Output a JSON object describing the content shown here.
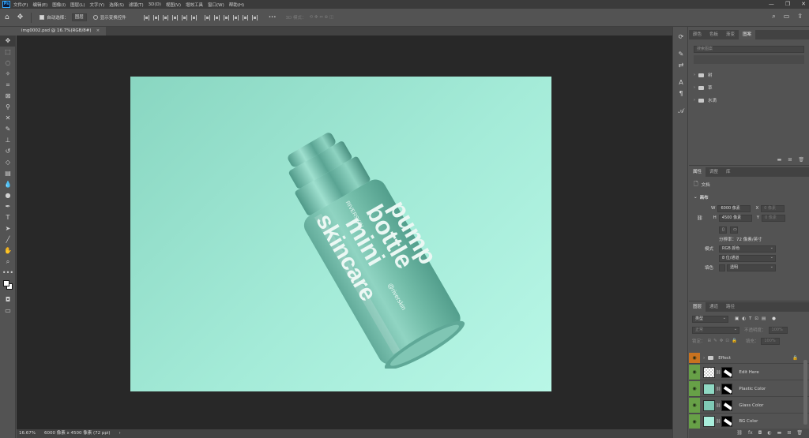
{
  "menu": {
    "logo": "Ps",
    "items": [
      "文件(F)",
      "编辑(E)",
      "图像(I)",
      "图层(L)",
      "文字(Y)",
      "选择(S)",
      "滤镜(T)",
      "3D(D)",
      "视图(V)",
      "增效工具",
      "窗口(W)",
      "帮助(H)"
    ],
    "window_controls": [
      "—",
      "❐",
      "✕"
    ]
  },
  "options": {
    "auto_select_label": "自动选择：",
    "auto_select_value": "图层",
    "show_transform_label": "显示变换控件",
    "more": "•••",
    "mode_3d_label": "3D 模式："
  },
  "document": {
    "tab_title": "img0002.psd @ 16.7%(RGB/8#)",
    "close": "×"
  },
  "status": {
    "zoom": "16.67%",
    "size_info": "6000 像素 x 4500 像素 (72 ppi)",
    "arrow": "›"
  },
  "library_panel": {
    "tabs": [
      "颜色",
      "色板",
      "渐变",
      "图案"
    ],
    "active_tab": 3,
    "search_placeholder": "搜索图案",
    "folders": [
      "树",
      "草",
      "水滴"
    ]
  },
  "properties_panel": {
    "tabs": [
      "属性",
      "调整",
      "库"
    ],
    "active_tab": 0,
    "doc_label": "文档",
    "section_title": "画布",
    "w_label": "W",
    "w_value": "6000 像素",
    "h_label": "H",
    "h_value": "4500 像素",
    "x_label": "X",
    "x_value": "0 像素",
    "y_label": "Y",
    "y_value": "0 像素",
    "resolution": "分辨率：72 像素/英寸",
    "mode_label": "模式",
    "mode_value": "RGB 颜色",
    "depth_value": "8 位/通道",
    "fill_label": "填色",
    "fill_value": "透明"
  },
  "layers_panel": {
    "tabs": [
      "图层",
      "通道",
      "路径"
    ],
    "active_tab": 0,
    "filter_value": "类型",
    "blend_mode": "正常",
    "opacity_label": "不透明度：",
    "opacity_value": "100%",
    "lock_label": "锁定：",
    "fill_label": "填充：",
    "fill_value": "100%",
    "layers": [
      {
        "name": "Effect",
        "type": "group",
        "thumb": "#535353"
      },
      {
        "name": "Edit Here",
        "type": "smart",
        "thumb": "#ffffff"
      },
      {
        "name": "Plastic Color",
        "type": "fill",
        "thumb": "#8fd8c3"
      },
      {
        "name": "Glass Color",
        "type": "fill",
        "thumb": "#7fc9b5"
      },
      {
        "name": "BG Color",
        "type": "fill",
        "thumb": "#a9eedc"
      }
    ]
  },
  "canvas": {
    "bottle_text_1": "skincare",
    "bottle_text_2": "mini",
    "bottle_text_3": "bottle",
    "bottle_text_4": "pump",
    "bottle_small_1": "RIVERSKIN",
    "bottle_small_2": "@riverskin",
    "bg_color": "#a4ebd8",
    "bottle_color": "#6fb9a5"
  }
}
